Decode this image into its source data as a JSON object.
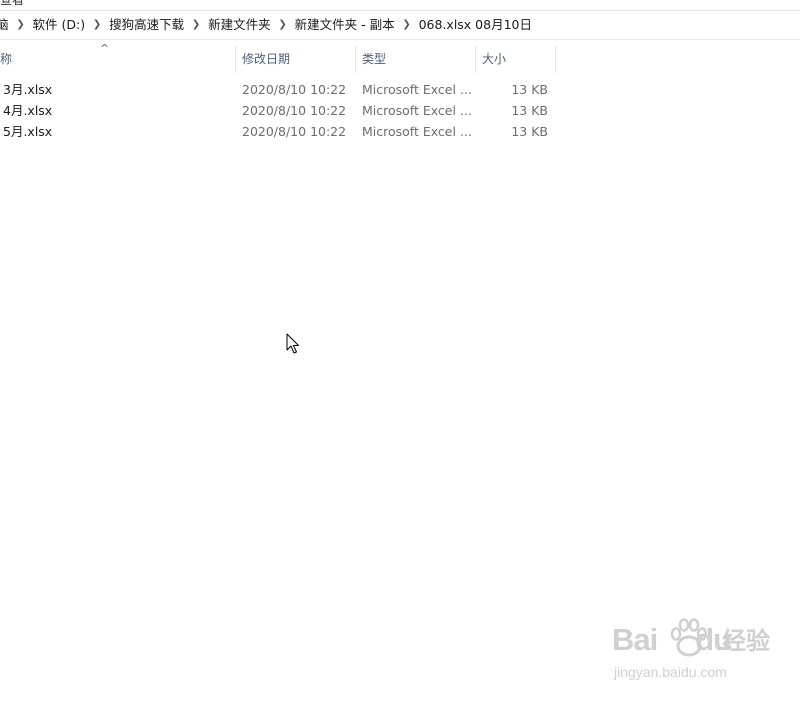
{
  "ribbon": {
    "cut_text": "查看"
  },
  "breadcrumb": [
    {
      "label": "脑"
    },
    {
      "label": "软件 (D:)"
    },
    {
      "label": "搜狗高速下载"
    },
    {
      "label": "新建文件夹"
    },
    {
      "label": "新建文件夹 - 副本"
    },
    {
      "label": "068.xlsx 08月10日"
    }
  ],
  "columns": {
    "name": "称",
    "date": "修改日期",
    "type": "类型",
    "size": "大小",
    "sort_indicator": "^"
  },
  "files": [
    {
      "name": "3月.xlsx",
      "date": "2020/8/10 10:22",
      "type": "Microsoft Excel ...",
      "size": "13 KB"
    },
    {
      "name": "4月.xlsx",
      "date": "2020/8/10 10:22",
      "type": "Microsoft Excel ...",
      "size": "13 KB"
    },
    {
      "name": "5月.xlsx",
      "date": "2020/8/10 10:22",
      "type": "Microsoft Excel ...",
      "size": "13 KB"
    }
  ],
  "watermark": {
    "logo_left": "Bai",
    "logo_right": "du",
    "brand": "经验",
    "url": "jingyan.baidu.com"
  },
  "icons": {
    "breadcrumb_separator": "chevron-right-icon",
    "cursor": "mouse-pointer-icon",
    "watermark_paw": "baidu-paw-icon"
  }
}
